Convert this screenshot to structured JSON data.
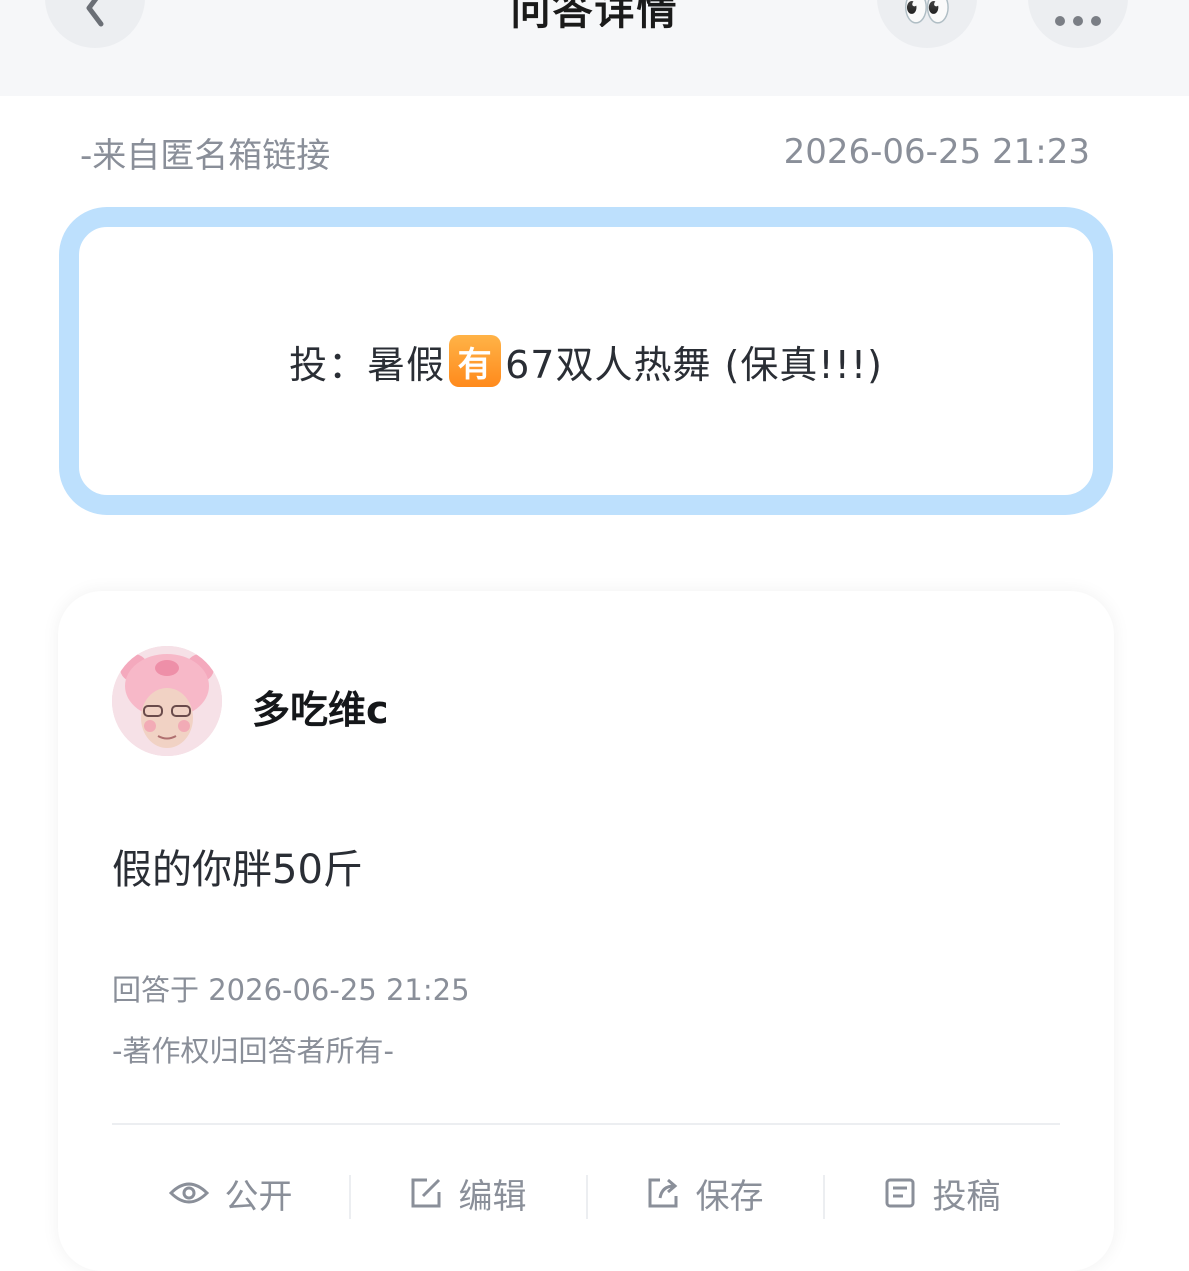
{
  "header": {
    "title": "问答详情",
    "back_icon": "chevron-left-icon",
    "eyes_emoji": "👀",
    "more_icon": "more-dots-icon"
  },
  "question": {
    "source": "-来自匿名箱链接",
    "timestamp": "2026-06-25 21:23",
    "text_before": "投：暑假",
    "badge": "有",
    "text_after": "67双人热舞 (保真!!!)",
    "border_color": "#bde0fd"
  },
  "answer": {
    "username": "多吃维c",
    "text": "假的你胖50斤",
    "answered_at": "回答于 2026-06-25 21:25",
    "copyright": "-著作权归回答者所有-"
  },
  "actions": [
    {
      "label": "公开",
      "icon": "eye-icon"
    },
    {
      "label": "编辑",
      "icon": "edit-icon"
    },
    {
      "label": "保存",
      "icon": "share-icon"
    },
    {
      "label": "投稿",
      "icon": "submit-icon"
    }
  ]
}
